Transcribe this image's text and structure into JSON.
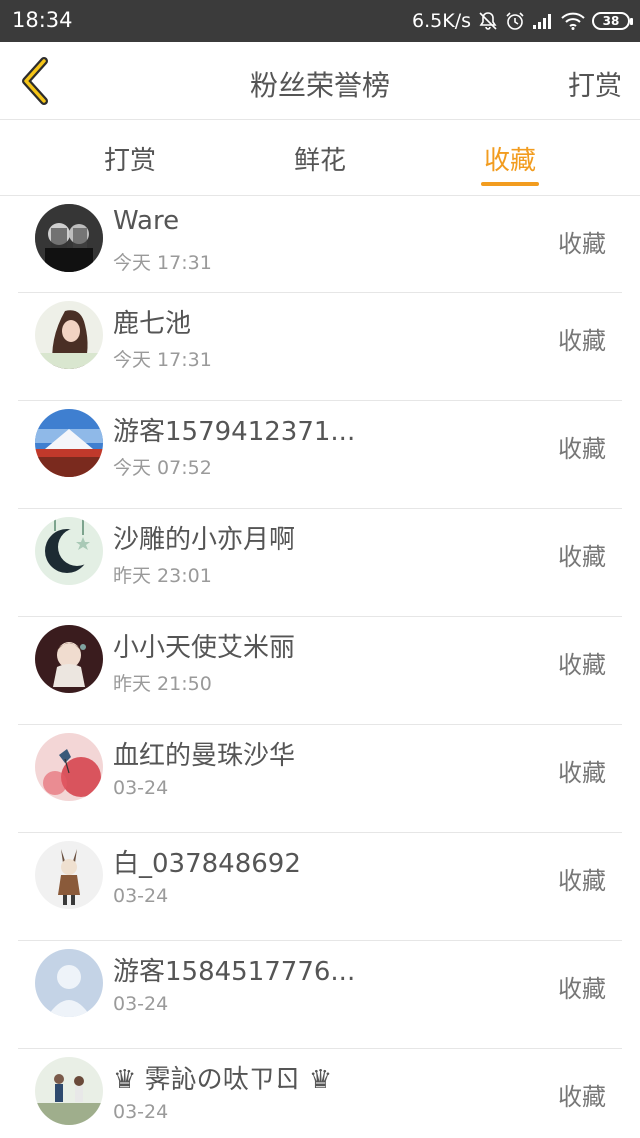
{
  "status_bar": {
    "time": "18:34",
    "net_speed": "6.5K/s",
    "battery": "38"
  },
  "nav": {
    "title": "粉丝荣誉榜",
    "action": "打赏",
    "back_icon": "chevron-left-icon"
  },
  "tabs": [
    {
      "label": "打赏",
      "active": false
    },
    {
      "label": "鲜花",
      "active": false
    },
    {
      "label": "收藏",
      "active": true
    }
  ],
  "colors": {
    "accent": "#f29c1f",
    "status_bar_bg": "#3b3b3b",
    "text": "#555555",
    "subtext": "#9a9a9a"
  },
  "list": [
    {
      "name": "Ware",
      "time": "今天 17:31",
      "action": "收藏",
      "avatar": "avatar-bw-photo"
    },
    {
      "name": "鹿七池",
      "time": "今天 17:31",
      "action": "收藏",
      "avatar": "avatar-girl-photo"
    },
    {
      "name": "游客1579412371...",
      "time": "今天 07:52",
      "action": "收藏",
      "avatar": "avatar-mountain-photo"
    },
    {
      "name": "沙雕的小亦月啊",
      "time": "昨天 23:01",
      "action": "收藏",
      "avatar": "avatar-moon-art"
    },
    {
      "name": "小小天使艾米丽",
      "time": "昨天 21:50",
      "action": "收藏",
      "avatar": "avatar-anime-girl"
    },
    {
      "name": "血红的曼珠沙华",
      "time": "03-24",
      "action": "收藏",
      "avatar": "avatar-red-flower"
    },
    {
      "name": "白_037848692",
      "time": "03-24",
      "action": "收藏",
      "avatar": "avatar-fox-figure"
    },
    {
      "name": "游客1584517776...",
      "time": "03-24",
      "action": "收藏",
      "avatar": "avatar-default-person"
    },
    {
      "name": "♛ 霁訫の呔ㄗㄖ ♛",
      "time": "03-24",
      "action": "收藏",
      "avatar": "avatar-couple-photo"
    }
  ]
}
